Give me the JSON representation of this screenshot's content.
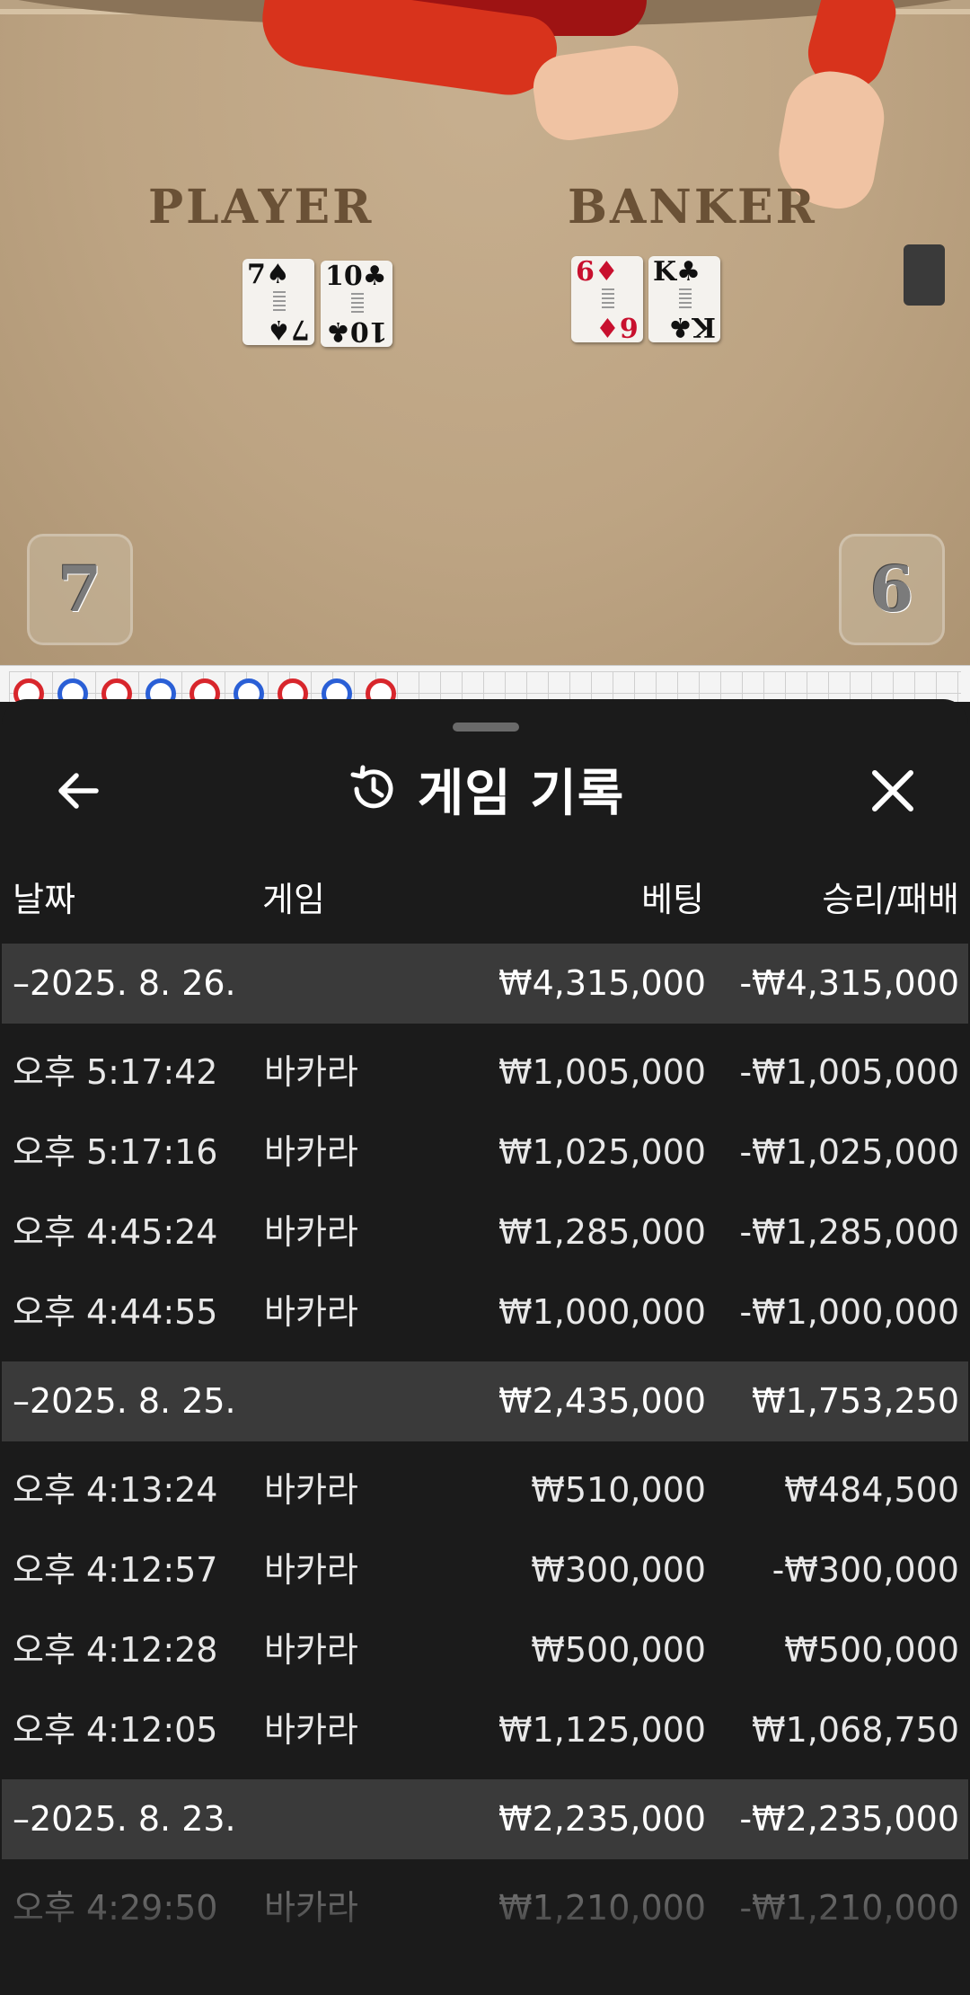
{
  "video": {
    "player_label": "PLAYER",
    "banker_label": "BANKER",
    "player_cards": [
      {
        "rank": "7",
        "suit": "♠",
        "color": "black"
      },
      {
        "rank": "10",
        "suit": "♣",
        "color": "black"
      }
    ],
    "banker_cards": [
      {
        "rank": "6",
        "suit": "♦",
        "color": "red"
      },
      {
        "rank": "K",
        "suit": "♣",
        "color": "black"
      }
    ],
    "player_score": "7",
    "banker_score": "6"
  },
  "roadmap": {
    "dots": [
      "b",
      "p",
      "b",
      "p",
      "b",
      "p",
      "b",
      "p",
      "b"
    ]
  },
  "sheet": {
    "title": "게임 기록",
    "back_icon": "arrow-left-icon",
    "history_icon": "history-icon",
    "close_icon": "close-icon",
    "columns": {
      "date": "날짜",
      "game": "게임",
      "bet": "베팅",
      "result": "승리/패배"
    },
    "groups": [
      {
        "date": "–2025. 8. 26.",
        "bet_total": "₩4,315,000",
        "result_total": "-₩4,315,000",
        "rows": [
          {
            "time": "오후 5:17:42",
            "game": "바카라",
            "bet": "₩1,005,000",
            "result": "-₩1,005,000"
          },
          {
            "time": "오후 5:17:16",
            "game": "바카라",
            "bet": "₩1,025,000",
            "result": "-₩1,025,000"
          },
          {
            "time": "오후 4:45:24",
            "game": "바카라",
            "bet": "₩1,285,000",
            "result": "-₩1,285,000"
          },
          {
            "time": "오후 4:44:55",
            "game": "바카라",
            "bet": "₩1,000,000",
            "result": "-₩1,000,000"
          }
        ]
      },
      {
        "date": "–2025. 8. 25.",
        "bet_total": "₩2,435,000",
        "result_total": "₩1,753,250",
        "rows": [
          {
            "time": "오후 4:13:24",
            "game": "바카라",
            "bet": "₩510,000",
            "result": "₩484,500"
          },
          {
            "time": "오후 4:12:57",
            "game": "바카라",
            "bet": "₩300,000",
            "result": "-₩300,000"
          },
          {
            "time": "오후 4:12:28",
            "game": "바카라",
            "bet": "₩500,000",
            "result": "₩500,000"
          },
          {
            "time": "오후 4:12:05",
            "game": "바카라",
            "bet": "₩1,125,000",
            "result": "₩1,068,750"
          }
        ]
      },
      {
        "date": "–2025. 8. 23.",
        "bet_total": "₩2,235,000",
        "result_total": "-₩2,235,000",
        "rows": [
          {
            "time": "오후 4:29:50",
            "game": "바카라",
            "bet": "₩1,210,000",
            "result": "-₩1,210,000"
          }
        ]
      }
    ]
  },
  "colors": {
    "sheet_bg": "#1b1b1b",
    "group_row_bg": "#3a3a3a",
    "player_blue": "#2a5fd6",
    "banker_red": "#d8262c"
  }
}
